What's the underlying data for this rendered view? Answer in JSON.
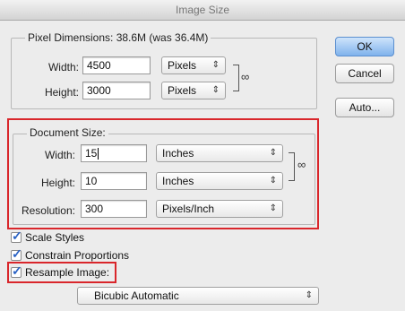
{
  "window": {
    "title": "Image Size"
  },
  "pixel_dimensions": {
    "legend": "Pixel Dimensions:  38.6M (was 36.4M)",
    "width_label": "Width:",
    "width_value": "4500",
    "width_unit": "Pixels",
    "height_label": "Height:",
    "height_value": "3000",
    "height_unit": "Pixels"
  },
  "document_size": {
    "legend": "Document Size:",
    "width_label": "Width:",
    "width_value": "15",
    "width_unit": "Inches",
    "height_label": "Height:",
    "height_value": "10",
    "height_unit": "Inches",
    "resolution_label": "Resolution:",
    "resolution_value": "300",
    "resolution_unit": "Pixels/Inch"
  },
  "buttons": {
    "ok": "OK",
    "cancel": "Cancel",
    "auto": "Auto..."
  },
  "options": {
    "scale_styles": {
      "label": "Scale Styles",
      "checked": true
    },
    "constrain_proportions": {
      "label": "Constrain Proportions",
      "checked": true
    },
    "resample_image": {
      "label": "Resample Image:",
      "checked": true
    },
    "resample_method": "Bicubic Automatic"
  },
  "icons": {
    "select_arrows": "⇕",
    "chain_link": "8",
    "checkmark": "✓"
  },
  "colors": {
    "highlight": "#d9262b",
    "default_button": "#7fb2ec",
    "checkmark": "#2a62c4"
  }
}
